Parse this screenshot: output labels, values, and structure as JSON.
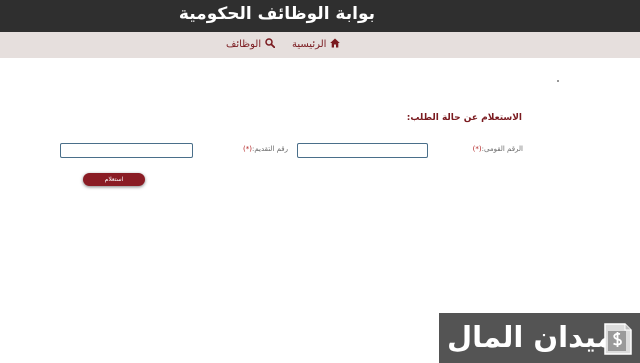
{
  "header": {
    "title": "بوابة الوظائف الحكومية"
  },
  "nav": {
    "home_label": "الرئيسية",
    "jobs_label": "الوظائف",
    "home_icon": "home-icon",
    "jobs_icon": "search-icon"
  },
  "form": {
    "section_title": "الاستعلام عن حالة الطلب:",
    "national_id_label": "الرقم القومى:",
    "application_no_label": "رقم التقديم:",
    "required_marker": "(*)",
    "national_id_value": "",
    "application_no_value": "",
    "submit_label": "استعلام"
  },
  "ad": {
    "text": "ميدان المال",
    "logo_icon": "money-document-icon"
  },
  "colors": {
    "accent": "#7a1a1f",
    "button": "#8a1c24",
    "topbar": "#2f2f2f",
    "navbar": "#e6dfdd"
  }
}
